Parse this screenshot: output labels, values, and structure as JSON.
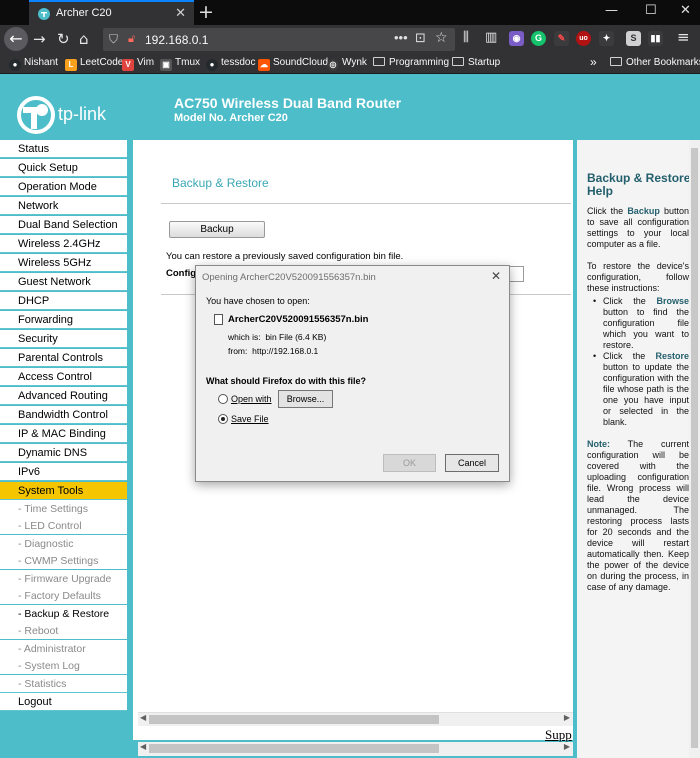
{
  "browser": {
    "tab_title": "Archer C20",
    "url": "192.168.0.1",
    "new_tab": "+",
    "bookmarks": [
      {
        "label": "Nishant",
        "icon": "github-icon",
        "color": "#24292e"
      },
      {
        "label": "LeetCode",
        "icon": "leetcode-icon",
        "color": "#f89f1b"
      },
      {
        "label": "Vim",
        "icon": "vim-icon",
        "color": "#e0443e"
      },
      {
        "label": "Tmux",
        "icon": "tmux-icon",
        "color": "#555555"
      },
      {
        "label": "tessdoc",
        "icon": "github-icon",
        "color": "#24292e"
      },
      {
        "label": "SoundCloud",
        "icon": "soundcloud-icon",
        "color": "#ff5500"
      },
      {
        "label": "Wynk",
        "icon": "wynk-icon",
        "color": "#3a3a3a"
      },
      {
        "label": "Programming",
        "icon": "folder-icon",
        "color": ""
      },
      {
        "label": "Startup",
        "icon": "folder-icon",
        "color": ""
      }
    ],
    "overflow": "»",
    "other_bookmarks": "Other Bookmarks"
  },
  "header": {
    "logo_text": "tp-link",
    "title": "AC750 Wireless Dual Band Router",
    "model": "Model No. Archer C20"
  },
  "menu": {
    "items": [
      "Status",
      "Quick Setup",
      "Operation Mode",
      "Network",
      "Dual Band Selection",
      "Wireless 2.4GHz",
      "Wireless 5GHz",
      "Guest Network",
      "DHCP",
      "Forwarding",
      "Security",
      "Parental Controls",
      "Access Control",
      "Advanced Routing",
      "Bandwidth Control",
      "IP & MAC Binding",
      "Dynamic DNS",
      "IPv6"
    ],
    "active": "System Tools",
    "subitems": [
      "- Time Settings",
      "- LED Control",
      "- Diagnostic",
      "- CWMP Settings",
      "- Firmware Upgrade",
      "- Factory Defaults",
      "- Backup & Restore",
      "- Reboot",
      "- Administrator",
      "- System Log",
      "- Statistics"
    ],
    "current_sub": "- Backup & Restore",
    "logout": "Logout"
  },
  "content": {
    "title": "Backup & Restore",
    "backup_button": "Backup",
    "restore_text": "You can restore a previously saved configuration bin file.",
    "config_label": "Configu",
    "support_link": "Supp"
  },
  "help": {
    "title": "Backup & Restore Help",
    "p1_a": "Click the ",
    "p1_b": "Backup",
    "p1_c": " button to save all configuration settings to your local computer as a file.",
    "p2": "To restore the device's configuration, follow these instructions:",
    "li1_a": "Click the ",
    "li1_b": "Browse",
    "li1_c": " button to find the configuration file which you want to restore.",
    "li2_a": "Click the ",
    "li2_b": "Restore",
    "li2_c": " button to update the configuration with the file whose path is the one you have input or selected in the blank.",
    "note_label": "Note:",
    "note_text": " The current configuration will be covered with the uploading configuration file. Wrong process will lead the device unmanaged. The restoring process lasts for 20 seconds and the device will restart automatically then. Keep the power of the device on during the process, in case of any damage."
  },
  "dialog": {
    "title": "Opening ArcherC20V520091556357n.bin",
    "chosen": "You have chosen to open:",
    "filename": "ArcherC20V520091556357n.bin",
    "which_is_label": "which is:",
    "which_is_value": "bin File (6.4 KB)",
    "from_label": "from:",
    "from_value": "http://192.168.0.1",
    "question": "What should Firefox do with this file?",
    "open_with": "Open with",
    "browse": "Browse...",
    "save_file": "Save File",
    "selected": "Save File",
    "ok": "OK",
    "cancel": "Cancel"
  }
}
